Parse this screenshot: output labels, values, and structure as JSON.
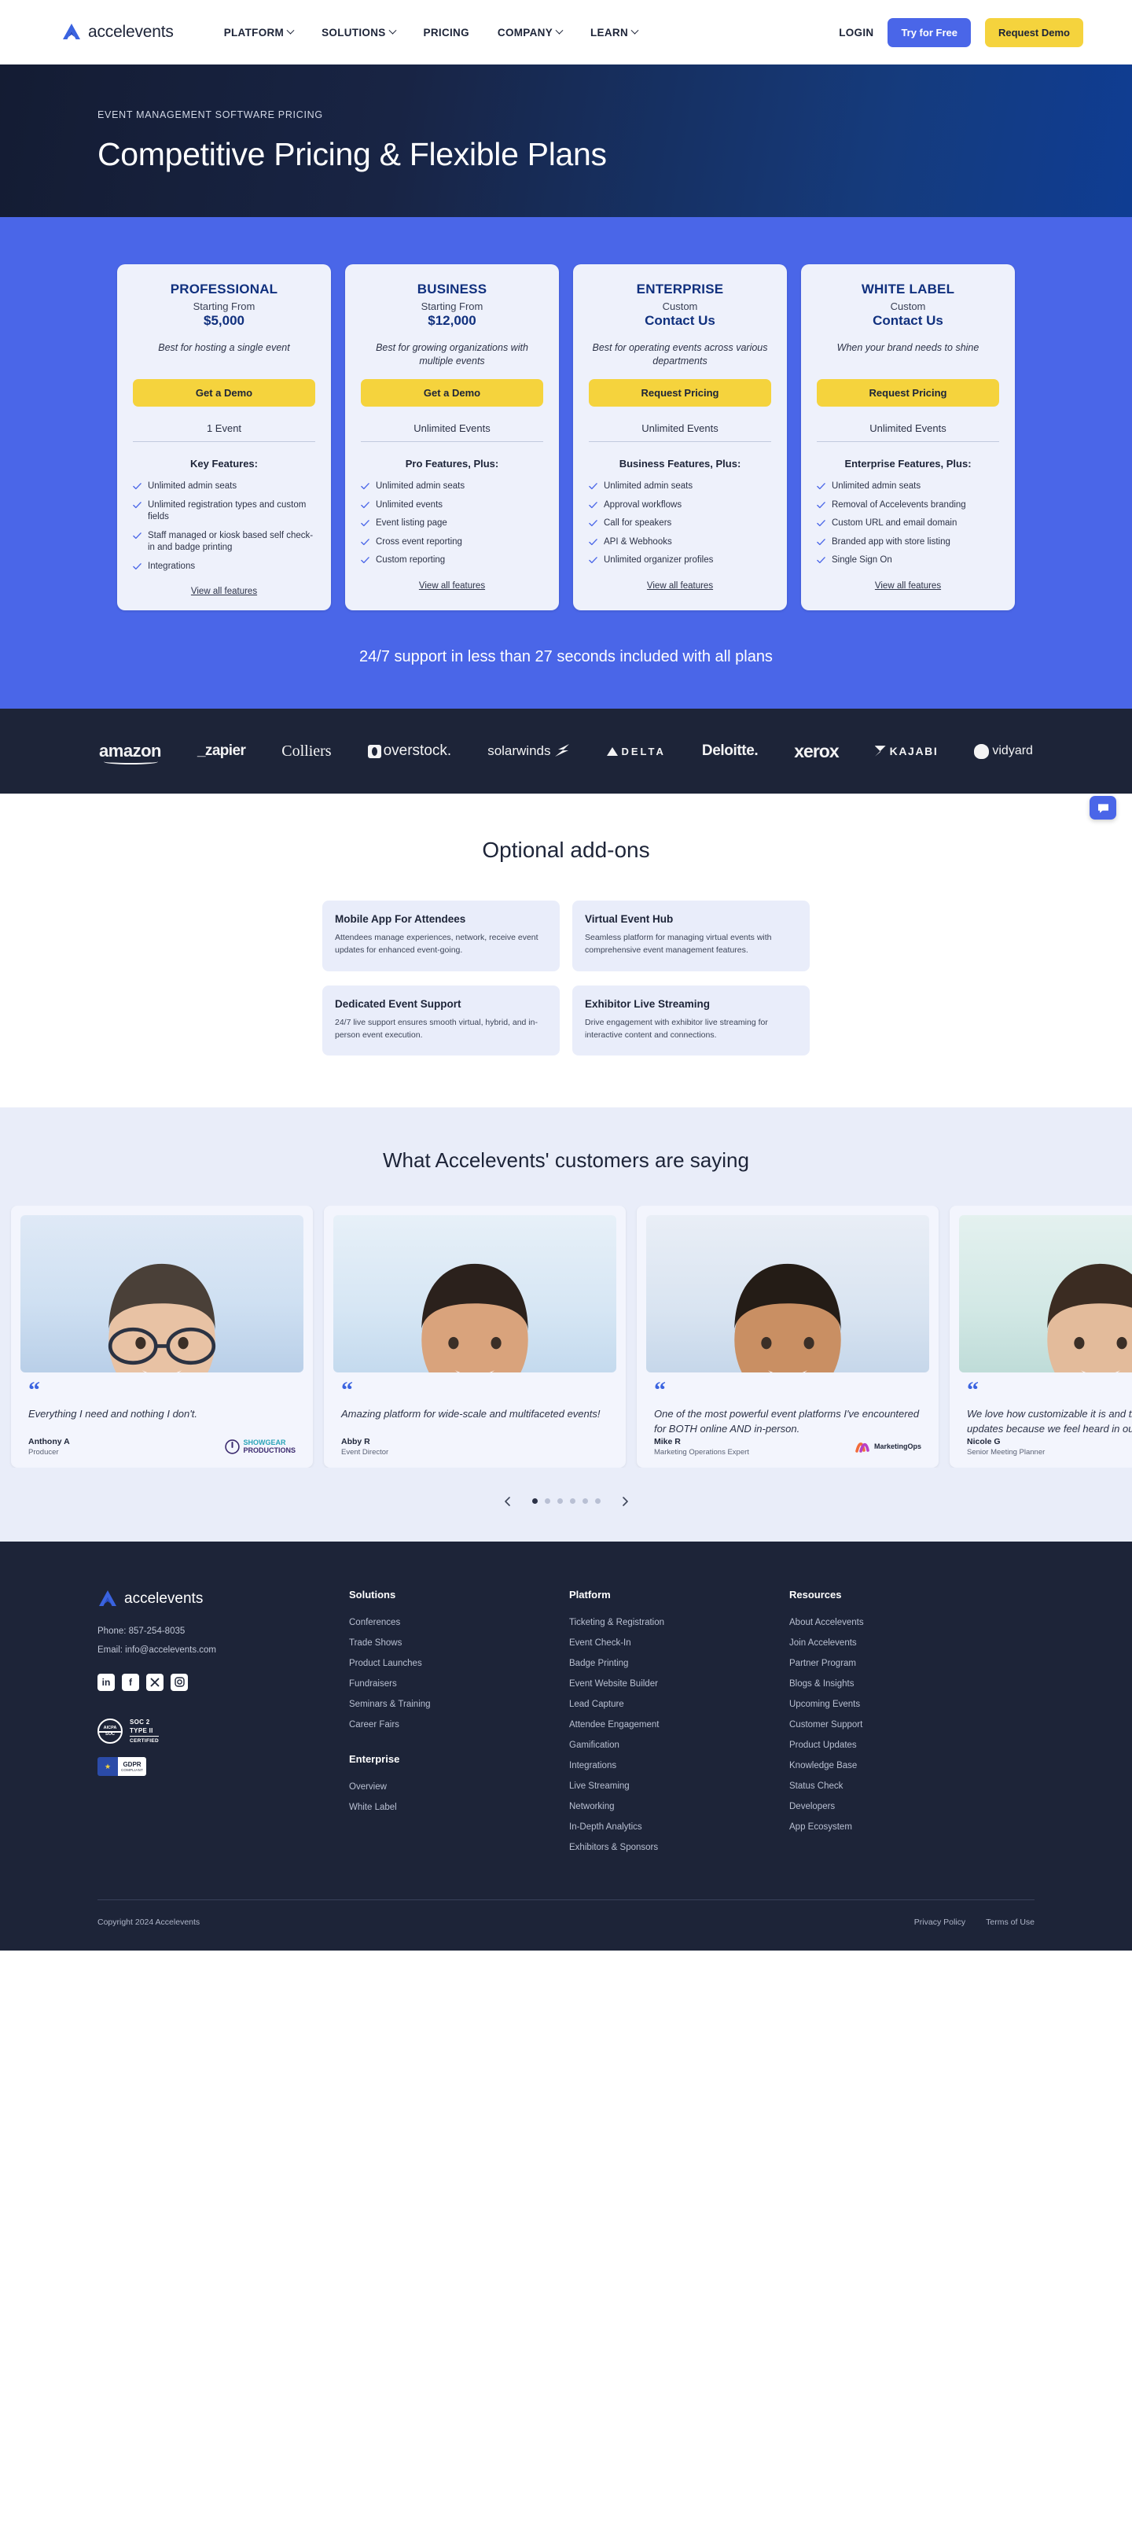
{
  "header": {
    "brand": "accelevents",
    "nav": [
      {
        "label": "PLATFORM",
        "caret": true
      },
      {
        "label": "SOLUTIONS",
        "caret": true
      },
      {
        "label": "PRICING",
        "caret": false
      },
      {
        "label": "COMPANY",
        "caret": true
      },
      {
        "label": "LEARN",
        "caret": true
      }
    ],
    "login": "LOGIN",
    "try_free": "Try for Free",
    "request_demo": "Request Demo",
    "accent_blue": "#4a66e8",
    "accent_yellow": "#f5d33d"
  },
  "hero": {
    "eyebrow": "EVENT MANAGEMENT SOFTWARE PRICING",
    "title": "Competitive Pricing & Flexible Plans"
  },
  "pricing": {
    "support_line": "24/7 support in less than 27 seconds included with all plans",
    "view_all_label": "View all features",
    "plans": [
      {
        "name": "PROFESSIONAL",
        "price_label": "Starting From",
        "price": "$5,000",
        "description": "Best for hosting a single event",
        "cta": "Get a Demo",
        "events": "1 Event",
        "features_heading": "Key Features:",
        "features": [
          "Unlimited admin seats",
          "Unlimited registration types and custom fields",
          "Staff managed or kiosk based self check-in and badge printing",
          "Integrations"
        ]
      },
      {
        "name": "BUSINESS",
        "price_label": "Starting From",
        "price": "$12,000",
        "description": "Best for growing organizations with multiple events",
        "cta": "Get a Demo",
        "events": "Unlimited Events",
        "features_heading": "Pro Features, Plus:",
        "features": [
          "Unlimited admin seats",
          "Unlimited events",
          "Event listing page",
          "Cross event reporting",
          "Custom reporting"
        ]
      },
      {
        "name": "ENTERPRISE",
        "price_label": "Custom",
        "price": "Contact Us",
        "description": "Best for operating events across various departments",
        "cta": "Request Pricing",
        "events": "Unlimited Events",
        "features_heading": "Business Features, Plus:",
        "features": [
          "Unlimited admin seats",
          "Approval workflows",
          "Call for speakers",
          "API & Webhooks",
          "Unlimited organizer profiles"
        ]
      },
      {
        "name": "WHITE LABEL",
        "price_label": "Custom",
        "price": "Contact Us",
        "description": "When your brand needs to shine",
        "cta": "Request Pricing",
        "events": "Unlimited Events",
        "features_heading": "Enterprise Features, Plus:",
        "features": [
          "Unlimited admin seats",
          "Removal of Accelevents branding",
          "Custom URL and email domain",
          "Branded app with store listing",
          "Single Sign On"
        ]
      }
    ]
  },
  "logos": [
    {
      "name": "amazon",
      "text": "amazon"
    },
    {
      "name": "zapier",
      "text": "_zapier"
    },
    {
      "name": "colliers",
      "text": "Colliers"
    },
    {
      "name": "overstock",
      "text": "overstock."
    },
    {
      "name": "solarwinds",
      "text": "solarwinds"
    },
    {
      "name": "delta",
      "text": "DELTA"
    },
    {
      "name": "deloitte",
      "text": "Deloitte."
    },
    {
      "name": "xerox",
      "text": "xerox"
    },
    {
      "name": "kajabi",
      "text": "KAJABI"
    },
    {
      "name": "vidyard",
      "text": "vidyard"
    }
  ],
  "addons": {
    "title": "Optional add-ons",
    "items": [
      {
        "title": "Mobile App For Attendees",
        "desc": "Attendees manage experiences, network, receive event updates for enhanced event-going."
      },
      {
        "title": "Virtual Event Hub",
        "desc": "Seamless platform for managing virtual events with comprehensive event management features."
      },
      {
        "title": "Dedicated Event Support",
        "desc": "24/7 live support ensures smooth virtual, hybrid, and in-person event execution."
      },
      {
        "title": "Exhibitor Live Streaming",
        "desc": "Drive engagement with exhibitor live streaming for interactive content and connections."
      }
    ]
  },
  "testimonials": {
    "title": "What Accelevents' customers are saying",
    "items": [
      {
        "quote": "Everything I need and nothing I don't.",
        "name": "Anthony A",
        "role": "Producer",
        "company": "SHOWGEAR PRODUCTIONS"
      },
      {
        "quote": "Amazing platform for wide-scale and multifaceted events!",
        "name": "Abby R",
        "role": "Event Director",
        "company": ""
      },
      {
        "quote": "One of the most powerful event platforms I've encountered for BOTH online AND in-person.",
        "name": "Mike R",
        "role": "Marketing Operations Expert",
        "company": "MarketingOps"
      },
      {
        "quote": "We love how customizable it is and the continuous updates because we feel heard in our feedback.",
        "name": "Nicole G",
        "role": "Senior Meeting Planner",
        "company": ""
      }
    ],
    "dots": 6,
    "active_dot": 0
  },
  "footer": {
    "brand": "accelevents",
    "phone": "Phone: 857-254-8035",
    "email": "Email: info@accelevents.com",
    "socials": [
      "linkedin",
      "facebook",
      "x-twitter",
      "instagram"
    ],
    "badges": {
      "soc2_line1": "SOC 2",
      "soc2_line2": "TYPE II",
      "soc2_line3": "CERTIFIED",
      "soc2_ring_top": "AICPA",
      "soc2_ring_bottom": "SOC",
      "gdpr_title": "GDPR",
      "gdpr_sub": "COMPLIANT"
    },
    "columns": [
      {
        "heading": "Solutions",
        "links": [
          "Conferences",
          "Trade Shows",
          "Product Launches",
          "Fundraisers",
          "Seminars & Training",
          "Career Fairs"
        ],
        "heading2": "Enterprise",
        "links2": [
          "Overview",
          "White Label"
        ]
      },
      {
        "heading": "Platform",
        "links": [
          "Ticketing & Registration",
          "Event Check-In",
          "Badge Printing",
          "Event Website Builder",
          "Lead Capture",
          "Attendee Engagement",
          "Gamification",
          "Integrations",
          "Live Streaming",
          "Networking",
          "In-Depth Analytics",
          "Exhibitors & Sponsors"
        ]
      },
      {
        "heading": "Resources",
        "links": [
          "About Accelevents",
          "Join Accelevents",
          "Partner Program",
          "Blogs & Insights",
          "Upcoming Events",
          "Customer Support",
          "Product Updates",
          "Knowledge Base",
          "Status Check",
          "Developers",
          "App Ecosystem"
        ]
      }
    ],
    "copyright": "Copyright 2024 Accelevents",
    "legal": [
      "Privacy Policy",
      "Terms of Use"
    ]
  }
}
